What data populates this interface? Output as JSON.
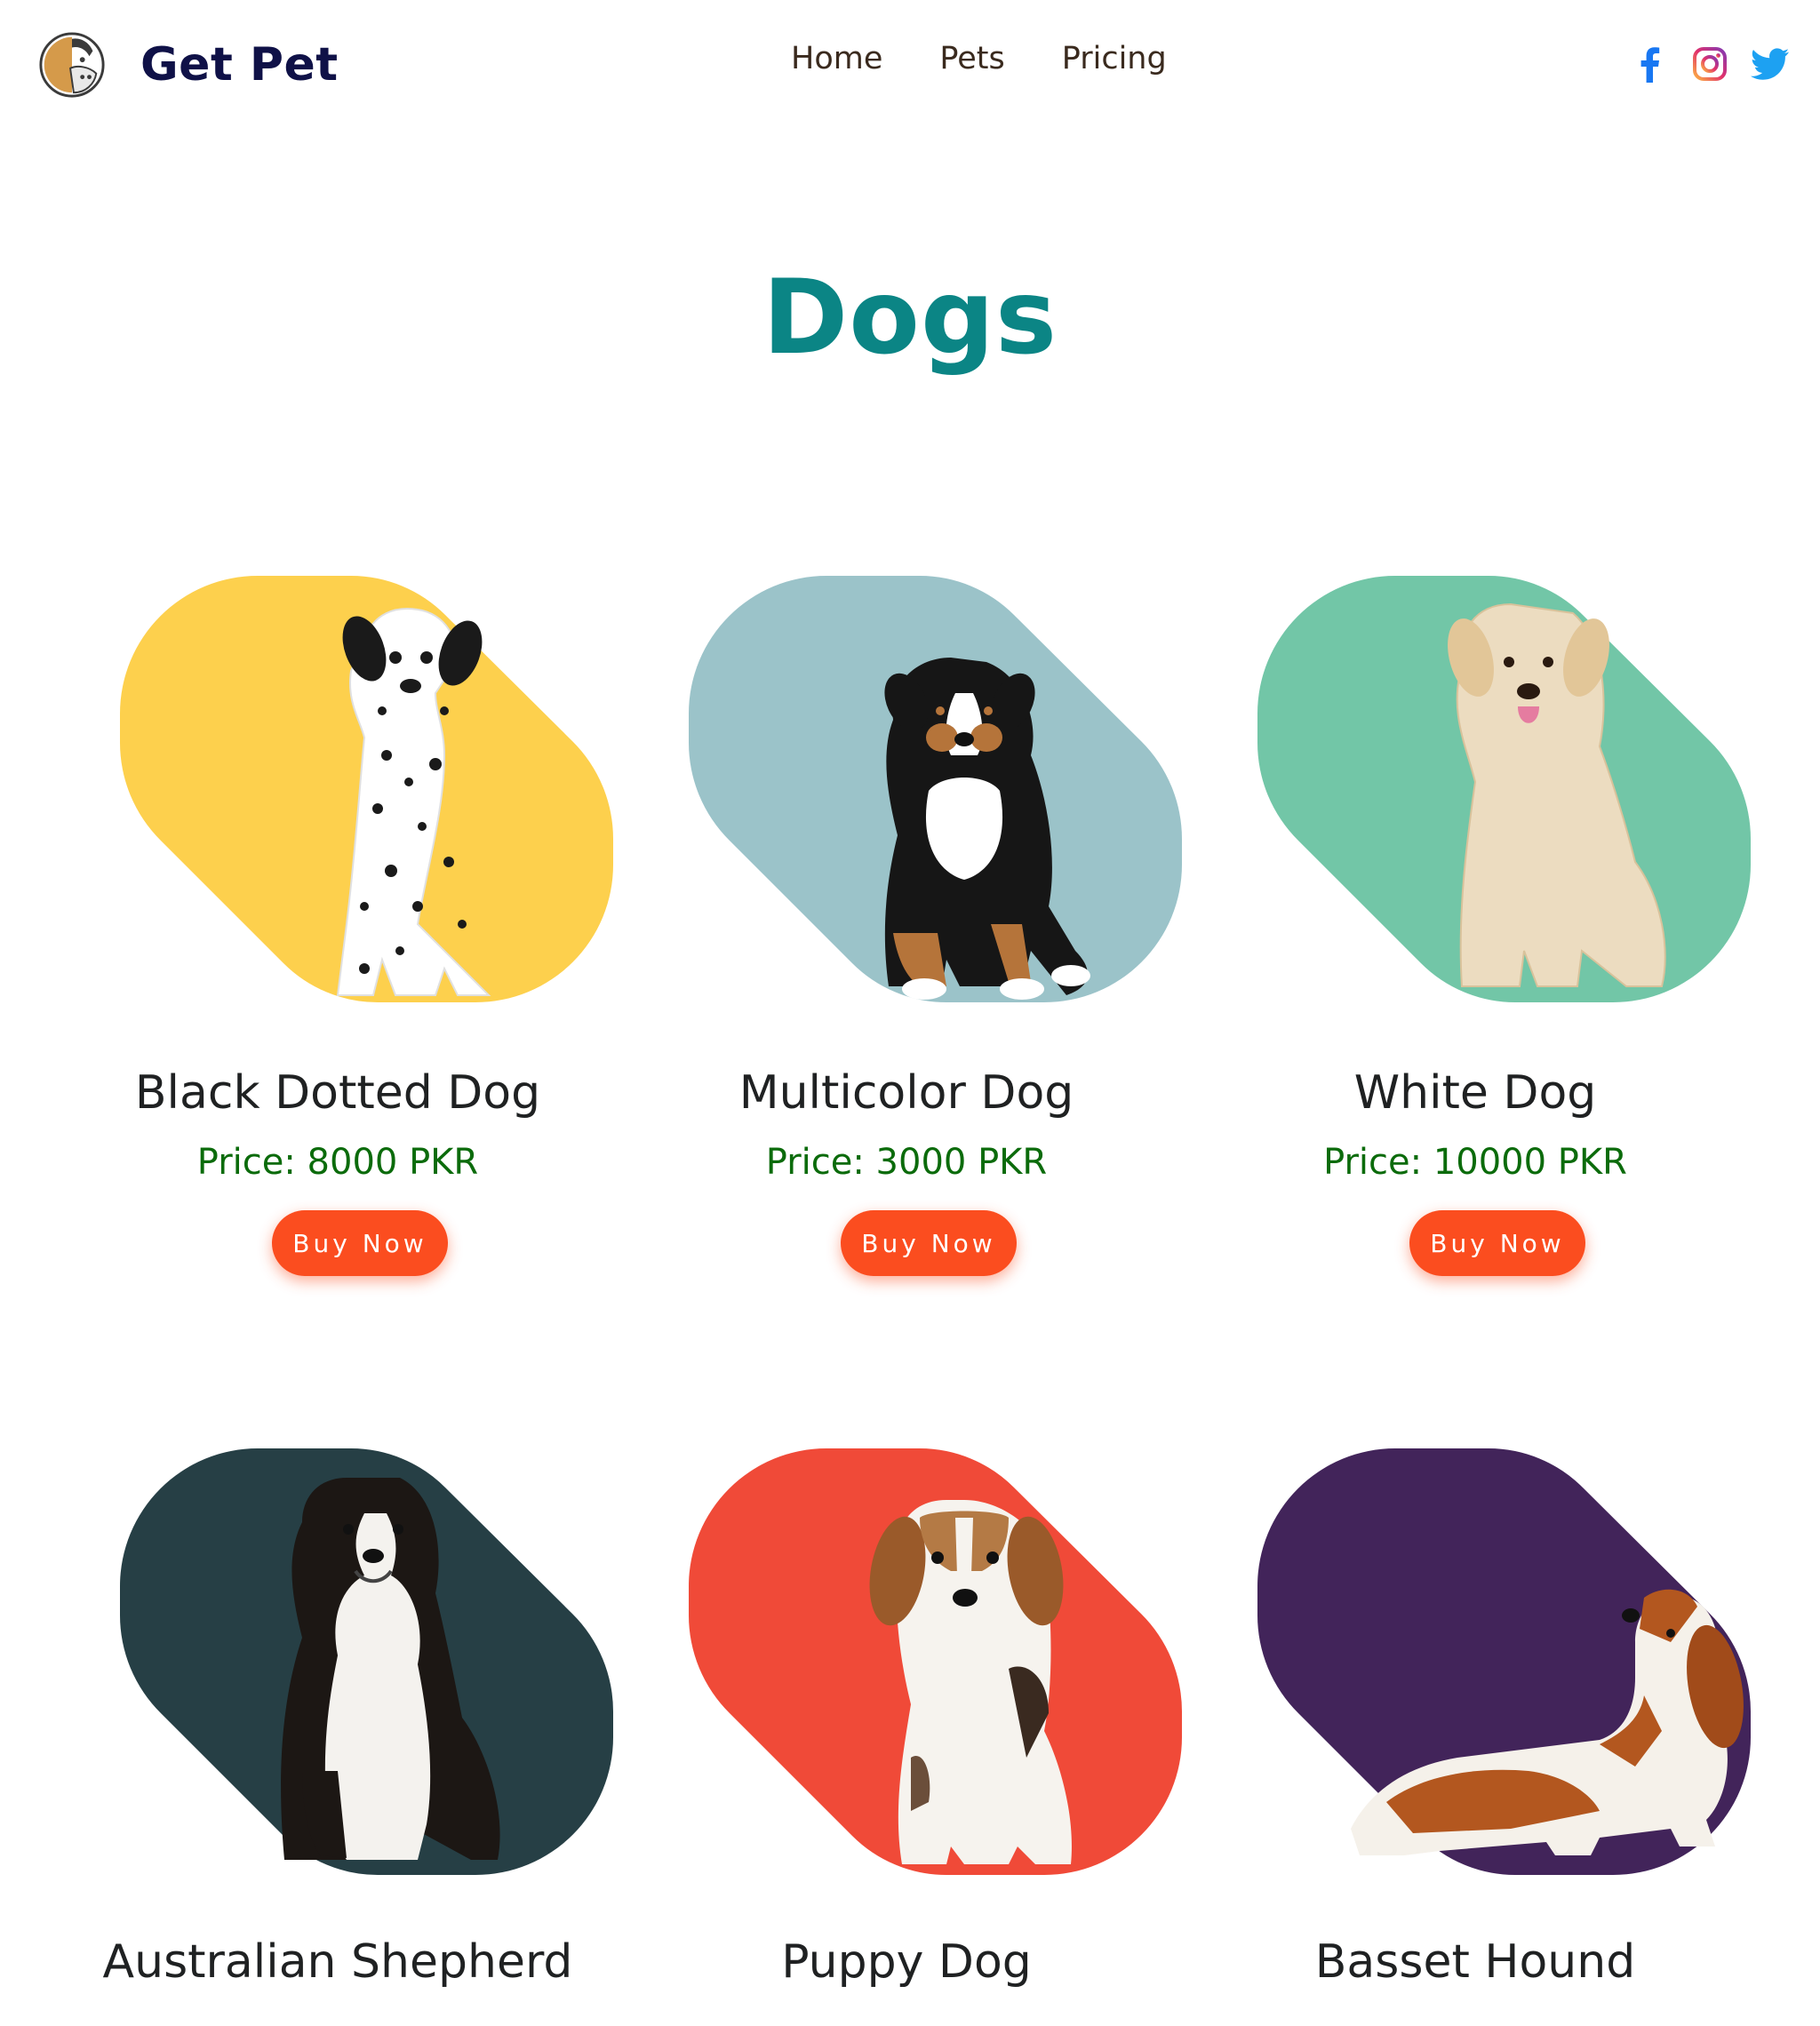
{
  "header": {
    "brand": "Get Pet",
    "nav": [
      "Home",
      "Pets",
      "Pricing"
    ],
    "socials": [
      {
        "icon": "facebook-icon",
        "color": "#1877f2"
      },
      {
        "icon": "instagram-icon",
        "color": "#d6249f"
      },
      {
        "icon": "twitter-icon",
        "color": "#1da1f2"
      }
    ]
  },
  "page": {
    "title": "Dogs",
    "button_label": "Buy Now"
  },
  "products": [
    {
      "name": "Black Dotted Dog",
      "price": "Price: 8000 PKR",
      "shape_color": "#fdd04d",
      "image": "dalmatian-puppy"
    },
    {
      "name": "Multicolor Dog",
      "price": "Price: 3000 PKR",
      "shape_color": "#9bc3c9",
      "image": "bernese-puppy"
    },
    {
      "name": "White Dog",
      "price": "Price: 10000 PKR",
      "shape_color": "#72c6a7",
      "image": "golden-retriever"
    },
    {
      "name": "Australian Shepherd",
      "price": "",
      "shape_color": "#263f45",
      "image": "australian-shepherd"
    },
    {
      "name": "Puppy Dog",
      "price": "",
      "shape_color": "#f04a38",
      "image": "beagle-puppy"
    },
    {
      "name": "Basset Hound",
      "price": "",
      "shape_color": "#42245a",
      "image": "basset-hound"
    }
  ]
}
